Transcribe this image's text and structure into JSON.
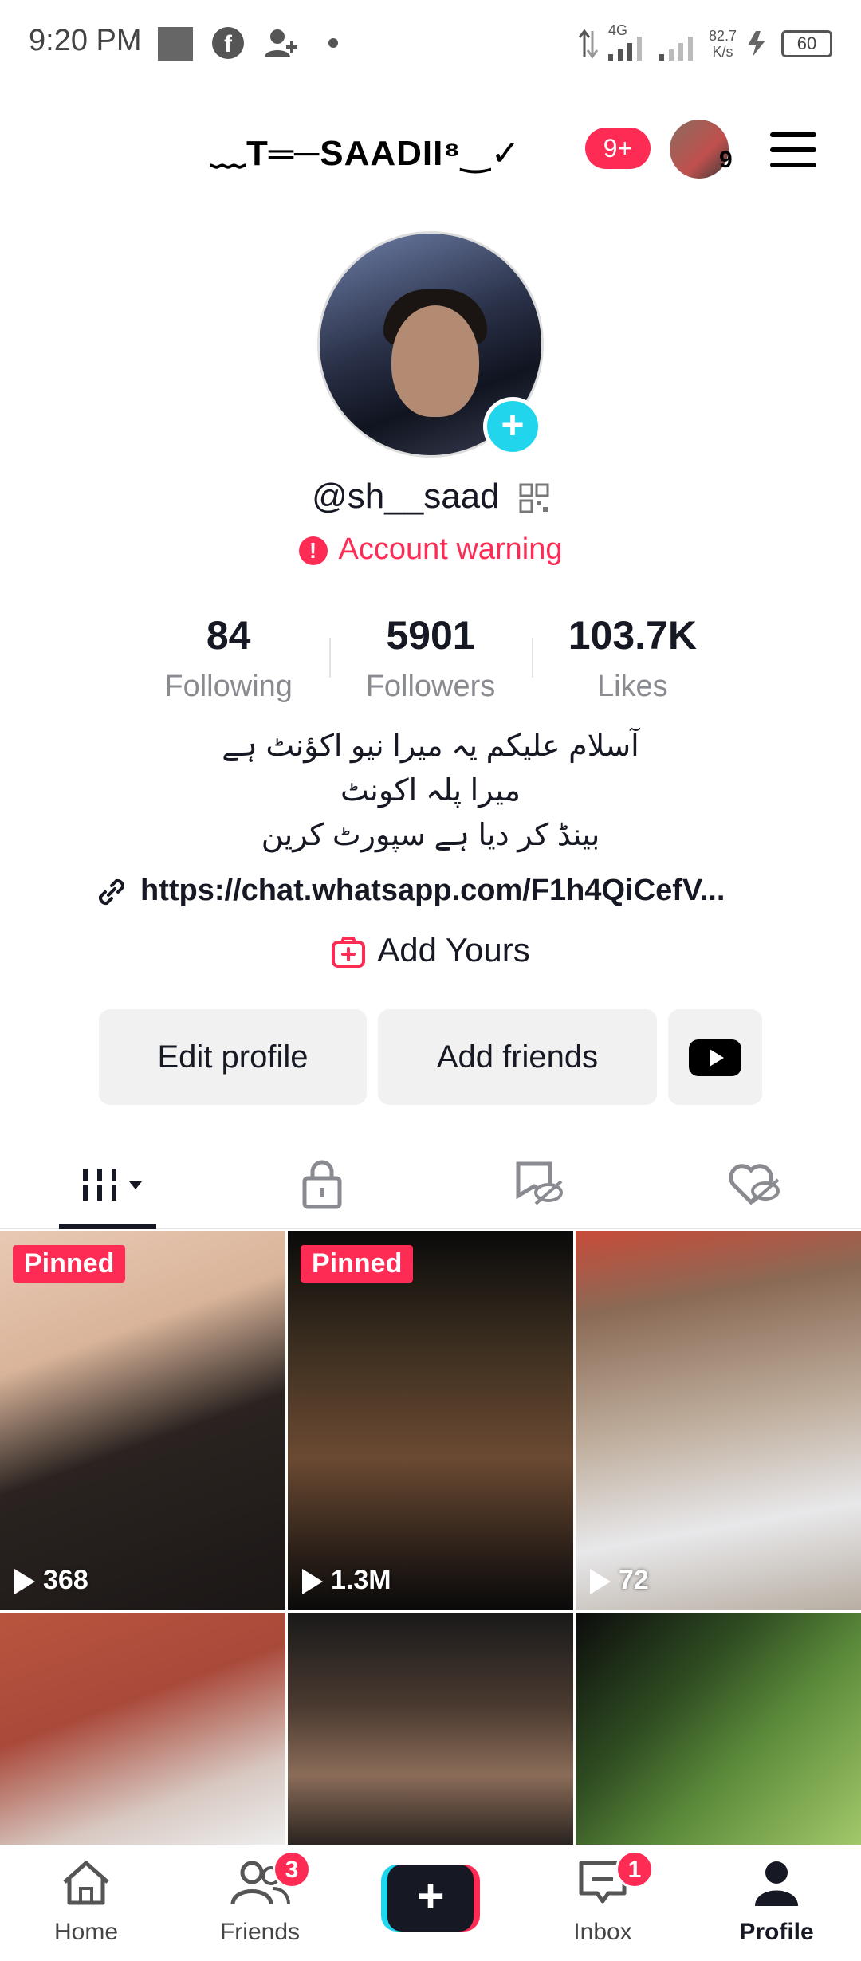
{
  "status_bar": {
    "time": "9:20 PM",
    "network_type": "4G",
    "speed_value": "82.7",
    "speed_unit": "K/s",
    "battery": "60"
  },
  "header": {
    "display_name": "﹏T═─SAADII⁸‿✓",
    "notification_count": "9+",
    "avatar_count": "9"
  },
  "profile": {
    "handle": "@sh__saad",
    "warning_text": "Account warning"
  },
  "stats": [
    {
      "value": "84",
      "label": "Following"
    },
    {
      "value": "5901",
      "label": "Followers"
    },
    {
      "value": "103.7K",
      "label": "Likes"
    }
  ],
  "bio": {
    "line1": "آسلام علیکم یہ میرا نیو اکؤنٹ ہے",
    "line2": "میرا پلہ  اکونٹ",
    "line3": "بینڈ کر دیا ہے سپورٹ کرین"
  },
  "link": "https://chat.whatsapp.com/F1h4QiCefV...",
  "add_yours": "Add Yours",
  "buttons": {
    "edit_profile": "Edit profile",
    "add_friends": "Add friends"
  },
  "videos": [
    {
      "pinned": "Pinned",
      "views": "368"
    },
    {
      "pinned": "Pinned",
      "views": "1.3M"
    },
    {
      "pinned": "",
      "views": "72"
    },
    {
      "pinned": "",
      "views": ""
    },
    {
      "pinned": "",
      "views": ""
    },
    {
      "pinned": "",
      "views": ""
    }
  ],
  "bottom_nav": {
    "home": "Home",
    "friends": "Friends",
    "friends_badge": "3",
    "inbox": "Inbox",
    "inbox_badge": "1",
    "profile": "Profile"
  },
  "colors": {
    "accent_red": "#fe2c55",
    "accent_cyan": "#20d5ec",
    "text_primary": "#161823",
    "text_secondary": "#8a8b91"
  }
}
